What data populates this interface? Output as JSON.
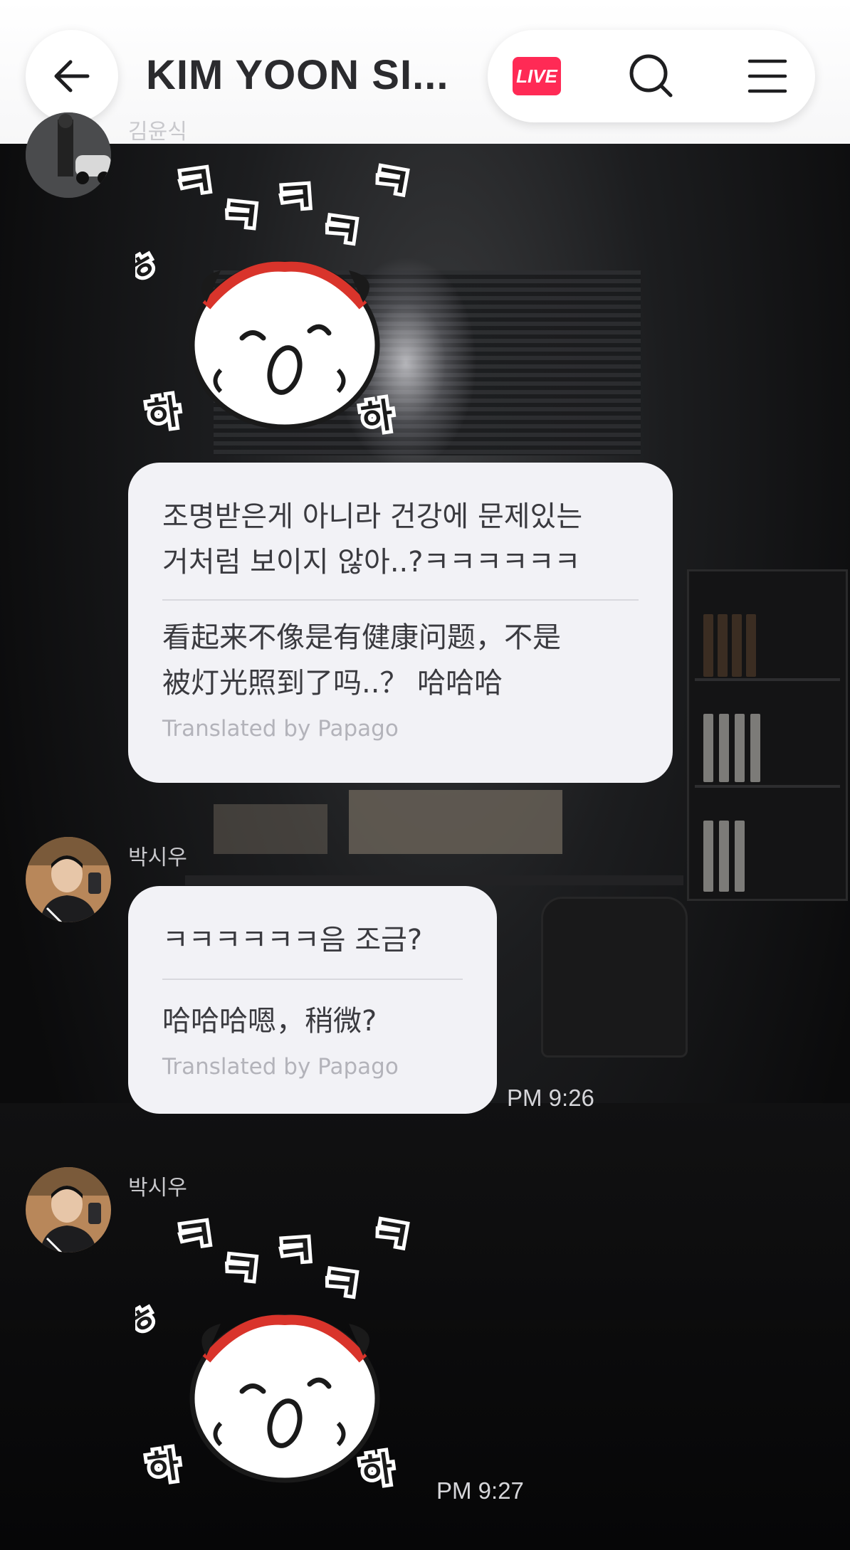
{
  "header": {
    "title": "KIM YOON SI...",
    "live_label": "LIVE",
    "icons": [
      "back-arrow-icon",
      "search-icon",
      "menu-icon"
    ],
    "accent_color": "#ff2a55"
  },
  "messages": [
    {
      "sender": "김윤식",
      "sticker_text": "ㅋㅋㅋㅋㅋ 하하",
      "sticker_big": "ㅋ",
      "sticker_side": "ㅎ",
      "sticker_bottom": "하"
    },
    {
      "korean_line1": "조명받은게 아니라 건강에 문제있는",
      "korean_line2": "거처럼 보이지 않아..?ㅋㅋㅋㅋㅋㅋ",
      "chinese_line1": "看起来不像是有健康问题，不是",
      "chinese_line2": "被灯光照到了吗..？ 哈哈哈",
      "translated_by": "Translated by Papago"
    },
    {
      "sender": "박시우",
      "korean": "ㅋㅋㅋㅋㅋㅋ음 조금?",
      "chinese": "哈哈哈嗯，稍微?",
      "translated_by": "Translated by Papago",
      "time": "PM 9:26"
    },
    {
      "sender": "박시우",
      "sticker_big": "ㅋ",
      "sticker_side": "ㅎ",
      "sticker_bottom": "하",
      "time": "PM 9:27"
    }
  ]
}
